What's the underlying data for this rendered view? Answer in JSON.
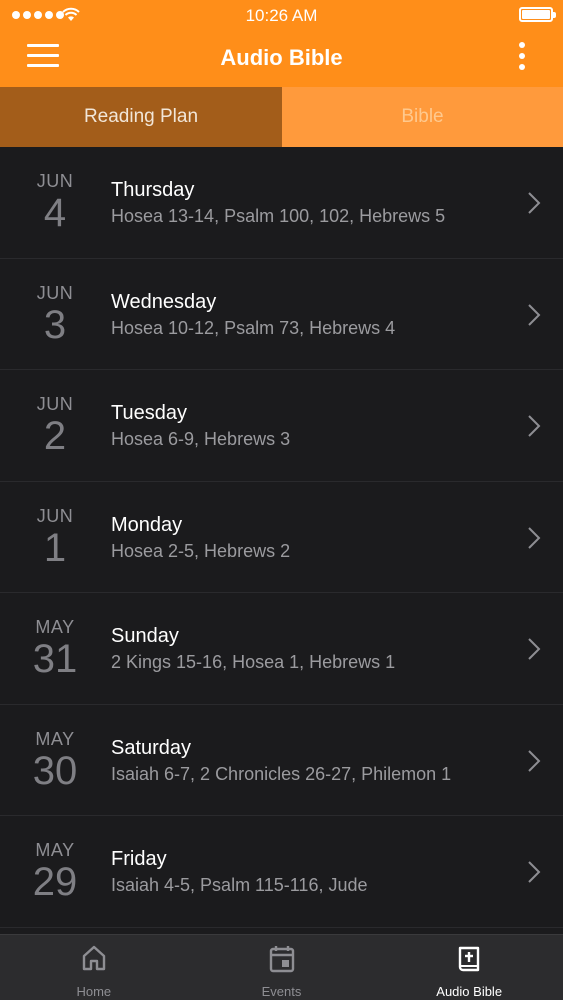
{
  "status_bar": {
    "time": "10:26 AM"
  },
  "header": {
    "title": "Audio Bible"
  },
  "tabs": [
    {
      "label": "Reading Plan"
    },
    {
      "label": "Bible"
    }
  ],
  "readings": [
    {
      "month": "JUN",
      "day": "4",
      "weekday": "Thursday",
      "passages": "Hosea 13-14, Psalm 100, 102, Hebrews 5"
    },
    {
      "month": "JUN",
      "day": "3",
      "weekday": "Wednesday",
      "passages": "Hosea 10-12, Psalm 73, Hebrews 4"
    },
    {
      "month": "JUN",
      "day": "2",
      "weekday": "Tuesday",
      "passages": "Hosea 6-9, Hebrews 3"
    },
    {
      "month": "JUN",
      "day": "1",
      "weekday": "Monday",
      "passages": "Hosea 2-5, Hebrews 2"
    },
    {
      "month": "MAY",
      "day": "31",
      "weekday": "Sunday",
      "passages": "2 Kings 15-16, Hosea 1, Hebrews 1"
    },
    {
      "month": "MAY",
      "day": "30",
      "weekday": "Saturday",
      "passages": "Isaiah 6-7, 2 Chronicles 26-27, Philemon 1"
    },
    {
      "month": "MAY",
      "day": "29",
      "weekday": "Friday",
      "passages": "Isaiah 4-5, Psalm 115-116, Jude"
    }
  ],
  "tabbar": [
    {
      "label": "Home",
      "icon": "home-icon"
    },
    {
      "label": "Events",
      "icon": "calendar-icon"
    },
    {
      "label": "Audio Bible",
      "icon": "bible-icon"
    }
  ],
  "colors": {
    "accent": "#ff8e19",
    "active_tab": "#a35d1a",
    "background": "#1b1b1d"
  }
}
